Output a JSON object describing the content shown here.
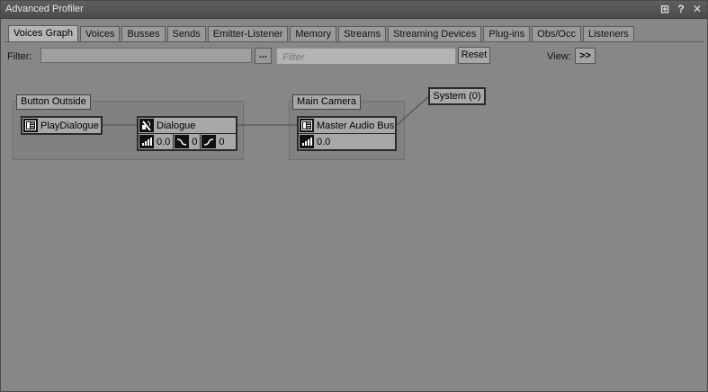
{
  "window": {
    "title": "Advanced Profiler"
  },
  "titlebar_controls": [
    {
      "name": "layout-icon",
      "glyph": "⊞"
    },
    {
      "name": "help-icon",
      "glyph": "?"
    },
    {
      "name": "close-icon",
      "glyph": "✕"
    }
  ],
  "tabs": [
    {
      "label": "Voices Graph",
      "active": true
    },
    {
      "label": "Voices"
    },
    {
      "label": "Busses"
    },
    {
      "label": "Sends"
    },
    {
      "label": "Emitter-Listener"
    },
    {
      "label": "Memory"
    },
    {
      "label": "Streams"
    },
    {
      "label": "Streaming Devices"
    },
    {
      "label": "Plug-ins"
    },
    {
      "label": "Obs/Occ"
    },
    {
      "label": "Listeners"
    }
  ],
  "toolbar": {
    "filter_label": "Filter:",
    "browse_label": "...",
    "filter_placeholder": "Filter",
    "reset_label": "Reset",
    "view_label": "View:",
    "view_button": ">>"
  },
  "graph": {
    "groups": [
      {
        "label": "Button Outside"
      },
      {
        "label": "Main Camera"
      }
    ],
    "event_node": {
      "label": "PlayDialogue",
      "icon": "event-icon"
    },
    "sound_node": {
      "label": "Dialogue",
      "icon": "sound-icon",
      "volume": "0.0",
      "lowpass": "0",
      "highpass": "0"
    },
    "bus_node": {
      "label": "Master Audio Bus",
      "icon": "bus-icon",
      "volume": "0.0"
    },
    "system_node": {
      "label": "System (0)"
    }
  },
  "colors": {
    "background": "#878787",
    "node": "#a8a8a8",
    "titlebar": "#505050"
  }
}
